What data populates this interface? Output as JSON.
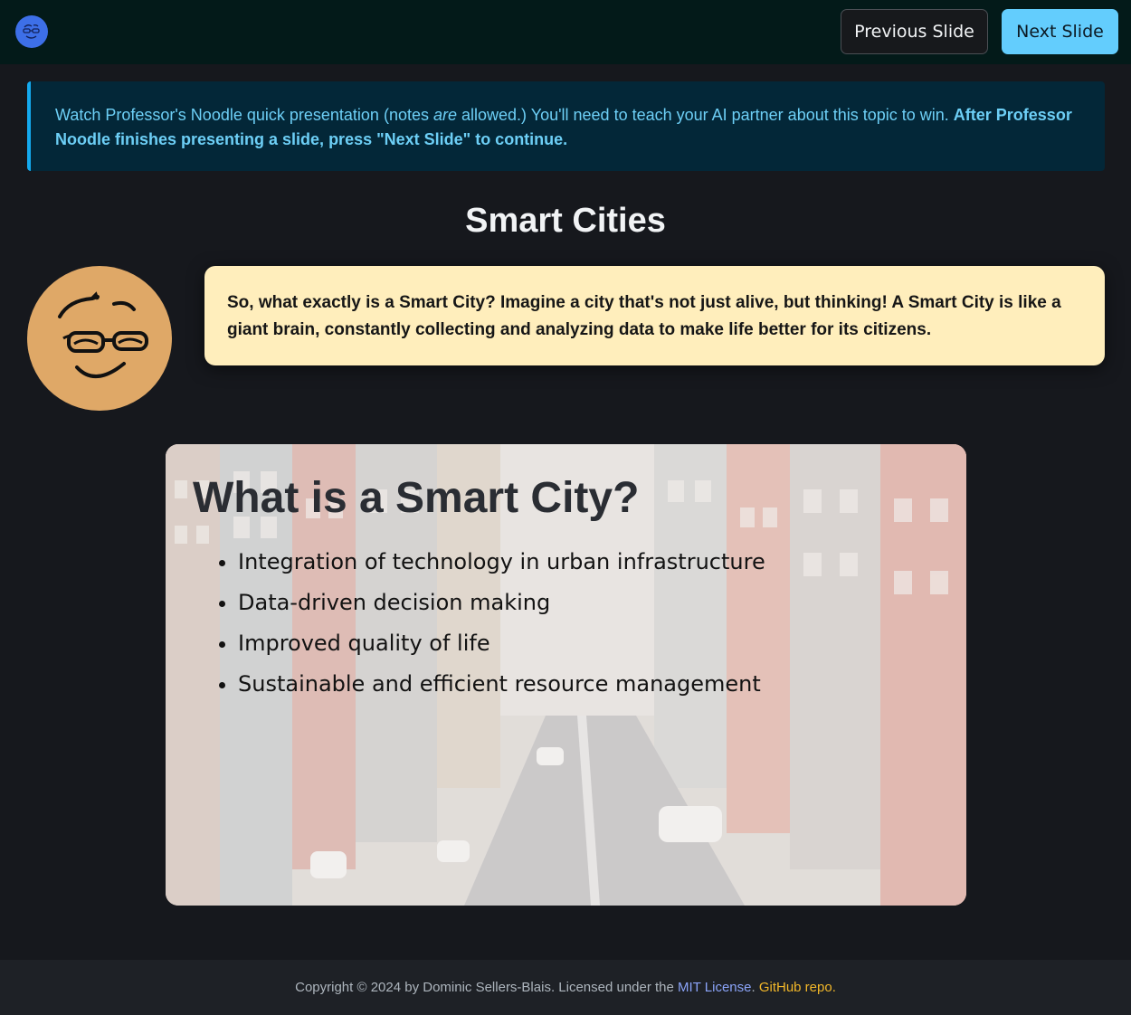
{
  "navbar": {
    "logo_icon": "professor-noodle-logo-icon",
    "prev_label": "Previous Slide",
    "next_label": "Next Slide"
  },
  "alert": {
    "text_1": "Watch Professor's Noodle quick presentation (notes ",
    "text_em": "are",
    "text_2": " allowed.) You'll need to teach your AI partner about this topic to win. ",
    "text_strong": "After Professor Noodle finishes presenting a slide, press \"Next Slide\" to continue."
  },
  "page": {
    "title": "Smart Cities"
  },
  "presenter": {
    "avatar_icon": "professor-noodle-avatar-icon",
    "speech": "So, what exactly is a Smart City? Imagine a city that's not just alive, but thinking! A Smart City is like a giant brain, constantly collecting and analyzing data to make life better for its citizens."
  },
  "slide": {
    "background": "city-street-illustration",
    "heading": "What is a Smart City?",
    "bullets": [
      "Integration of technology in urban infrastructure",
      "Data-driven decision making",
      "Improved quality of life",
      "Sustainable and efficient resource management"
    ]
  },
  "footer": {
    "copyright": "Copyright © 2024 by Dominic Sellers-Blais. Licensed under the ",
    "license_link": "MIT License",
    "separator": ". ",
    "repo_link": "GitHub repo."
  },
  "colors": {
    "navbar_bg": "#031a19",
    "next_button": "#63cdfd",
    "alert_bg": "#032738",
    "alert_text": "#6dcff6",
    "bubble_bg": "#ffeebc",
    "avatar_bg": "#dfa867",
    "mit_link": "#8ba4f9",
    "github_link": "#f2b729"
  }
}
